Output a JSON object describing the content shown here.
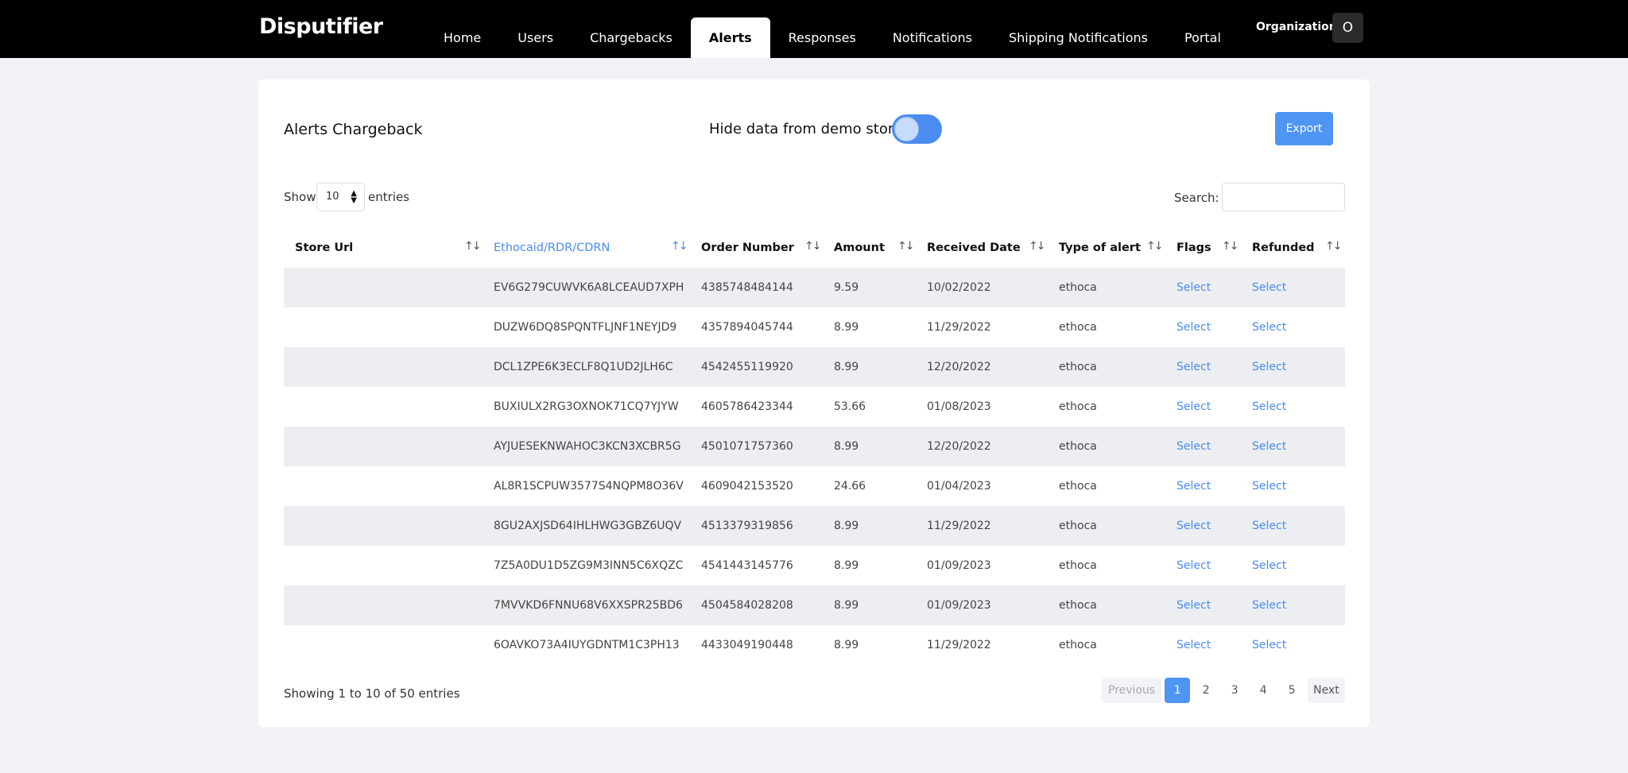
{
  "app": {
    "logo": "Disputifier"
  },
  "nav": {
    "tabs": [
      {
        "label": "Home"
      },
      {
        "label": "Users"
      },
      {
        "label": "Chargebacks"
      },
      {
        "label": "Alerts",
        "active": true
      },
      {
        "label": "Responses"
      },
      {
        "label": "Notifications"
      },
      {
        "label": "Shipping Notifications"
      },
      {
        "label": "Portal"
      }
    ],
    "org_label": "Organization",
    "avatar_initial": "O"
  },
  "card": {
    "title": "Alerts Chargeback",
    "demo_toggle_label": "Hide data from demo store",
    "demo_toggle_on": true,
    "export_label": "Export"
  },
  "controls": {
    "show_label": "Show",
    "page_size": "10",
    "entries_label": "entries",
    "search_label": "Search:",
    "search_value": ""
  },
  "table": {
    "columns": [
      "Store Url",
      "Ethocaid/RDR/CDRN",
      "Order Number",
      "Amount",
      "Received Date",
      "Type of alert",
      "Flags",
      "Refunded"
    ],
    "sorted_column": "Ethocaid/RDR/CDRN",
    "rows": [
      {
        "store_url": "",
        "ethoca_id": "EV6G279CUWVK6A8LCEAUD7XPH",
        "order_number": "4385748484144",
        "amount": "9.59",
        "received_date": "10/02/2022",
        "alert_type": "ethoca",
        "flags": "Select",
        "refunded": "Select"
      },
      {
        "store_url": "",
        "ethoca_id": "DUZW6DQ8SPQNTFLJNF1NEYJD9",
        "order_number": "4357894045744",
        "amount": "8.99",
        "received_date": "11/29/2022",
        "alert_type": "ethoca",
        "flags": "Select",
        "refunded": "Select"
      },
      {
        "store_url": "",
        "ethoca_id": "DCL1ZPE6K3ECLF8Q1UD2JLH6C",
        "order_number": "4542455119920",
        "amount": "8.99",
        "received_date": "12/20/2022",
        "alert_type": "ethoca",
        "flags": "Select",
        "refunded": "Select"
      },
      {
        "store_url": "",
        "ethoca_id": "BUXIULX2RG3OXNOK71CQ7YJYW",
        "order_number": "4605786423344",
        "amount": "53.66",
        "received_date": "01/08/2023",
        "alert_type": "ethoca",
        "flags": "Select",
        "refunded": "Select"
      },
      {
        "store_url": "",
        "ethoca_id": "AYJUESEKNWAHOC3KCN3XCBR5G",
        "order_number": "4501071757360",
        "amount": "8.99",
        "received_date": "12/20/2022",
        "alert_type": "ethoca",
        "flags": "Select",
        "refunded": "Select"
      },
      {
        "store_url": "",
        "ethoca_id": "AL8R1SCPUW3577S4NQPM8O36V",
        "order_number": "4609042153520",
        "amount": "24.66",
        "received_date": "01/04/2023",
        "alert_type": "ethoca",
        "flags": "Select",
        "refunded": "Select"
      },
      {
        "store_url": "",
        "ethoca_id": "8GU2AXJSD64IHLHWG3GBZ6UQV",
        "order_number": "4513379319856",
        "amount": "8.99",
        "received_date": "11/29/2022",
        "alert_type": "ethoca",
        "flags": "Select",
        "refunded": "Select"
      },
      {
        "store_url": "",
        "ethoca_id": "7Z5A0DU1D5ZG9M3INN5C6XQZC",
        "order_number": "4541443145776",
        "amount": "8.99",
        "received_date": "01/09/2023",
        "alert_type": "ethoca",
        "flags": "Select",
        "refunded": "Select"
      },
      {
        "store_url": "",
        "ethoca_id": "7MVVKD6FNNU68V6XXSPR25BD6",
        "order_number": "4504584028208",
        "amount": "8.99",
        "received_date": "01/09/2023",
        "alert_type": "ethoca",
        "flags": "Select",
        "refunded": "Select"
      },
      {
        "store_url": "",
        "ethoca_id": "6OAVKO73A4IUYGDNTM1C3PH13",
        "order_number": "4433049190448",
        "amount": "8.99",
        "received_date": "11/29/2022",
        "alert_type": "ethoca",
        "flags": "Select",
        "refunded": "Select"
      }
    ]
  },
  "footer": {
    "info": "Showing 1 to 10 of 50 entries",
    "previous_label": "Previous",
    "next_label": "Next",
    "pages": [
      "1",
      "2",
      "3",
      "4",
      "5"
    ],
    "current_page": "1"
  },
  "colors": {
    "accent": "#4e95f4",
    "topbar": "#000000",
    "background": "#f1f3f6",
    "stripe": "#eceef1"
  },
  "icons": {
    "sort": "sort-arrows-icon",
    "select_arrows": "updown-caret-icon"
  }
}
